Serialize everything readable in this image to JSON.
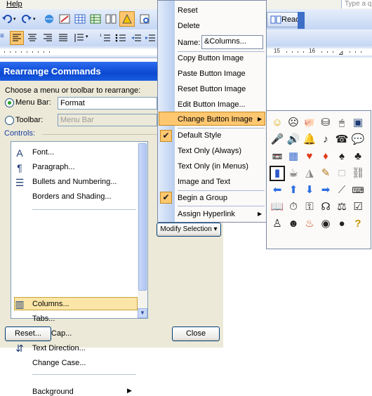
{
  "menubar": {
    "help": "Help",
    "type_question": "Type a q"
  },
  "toolbar": {
    "read_label": "Read"
  },
  "ruler": {
    "ticks": [
      "15",
      "16"
    ]
  },
  "dialog": {
    "title": "Rearrange Commands",
    "choose_label": "Choose a menu or toolbar to rearrange:",
    "menu_bar_label": "Menu Bar:",
    "menu_bar_value": "Format",
    "toolbar_label": "Toolbar:",
    "toolbar_value": "Menu Bar",
    "controls_label": "Controls:",
    "controls": [
      {
        "label": "Font...",
        "icon": "A"
      },
      {
        "label": "Paragraph...",
        "icon": "¶"
      },
      {
        "label": "Bullets and Numbering...",
        "icon": "☰"
      },
      {
        "label": "Borders and Shading..."
      },
      {
        "label": "Columns...",
        "icon": "▥"
      },
      {
        "label": "Tabs..."
      },
      {
        "label": "Drop Cap..."
      },
      {
        "label": "Text Direction...",
        "icon": "⇵"
      },
      {
        "label": "Change Case..."
      },
      {
        "label": "Background"
      }
    ],
    "reset_button": "Reset...",
    "close_button": "Close",
    "modify_selection": "Modify Selection ▾"
  },
  "menu": {
    "reset": "Reset",
    "delete": "Delete",
    "name_label": "Name:",
    "name_value": "&Columns...",
    "copy_image": "Copy Button Image",
    "paste_image": "Paste Button Image",
    "reset_image": "Reset Button Image",
    "edit_image": "Edit Button Image...",
    "change_image": "Change Button Image",
    "default_style": "Default Style",
    "text_only_always": "Text Only (Always)",
    "text_only_menus": "Text Only (in Menus)",
    "image_and_text": "Image and Text",
    "begin_group": "Begin a Group",
    "assign_hyperlink": "Assign Hyperlink"
  },
  "icons": [
    "smiley-icon",
    "frown-icon",
    "piggy-bank-icon",
    "paint-bucket-icon",
    "mouse-icon",
    "floppy-icon",
    "microphone-icon",
    "speaker-icon",
    "bell-icon",
    "music-note-icon",
    "telephone-icon",
    "speech-bubble-icon",
    "cassette-icon",
    "calculator-icon",
    "heart-icon",
    "diamond-icon",
    "spade-icon",
    "club-icon",
    "mug-icon",
    "cup-icon",
    "triangle-icon",
    "pencil-icon",
    "blank-icon",
    "link-icon",
    "left-arrow-icon",
    "up-arrow-icon",
    "down-arrow-icon",
    "right-arrow-icon",
    "dropper-icon",
    "keyboard-icon",
    "book-icon",
    "stopwatch-icon",
    "key-icon",
    "bell2-icon",
    "scales-icon",
    "checklist-icon",
    "person-icon",
    "head-icon",
    "fire-icon",
    "eye-icon",
    "8-ball-icon",
    "question-icon"
  ]
}
